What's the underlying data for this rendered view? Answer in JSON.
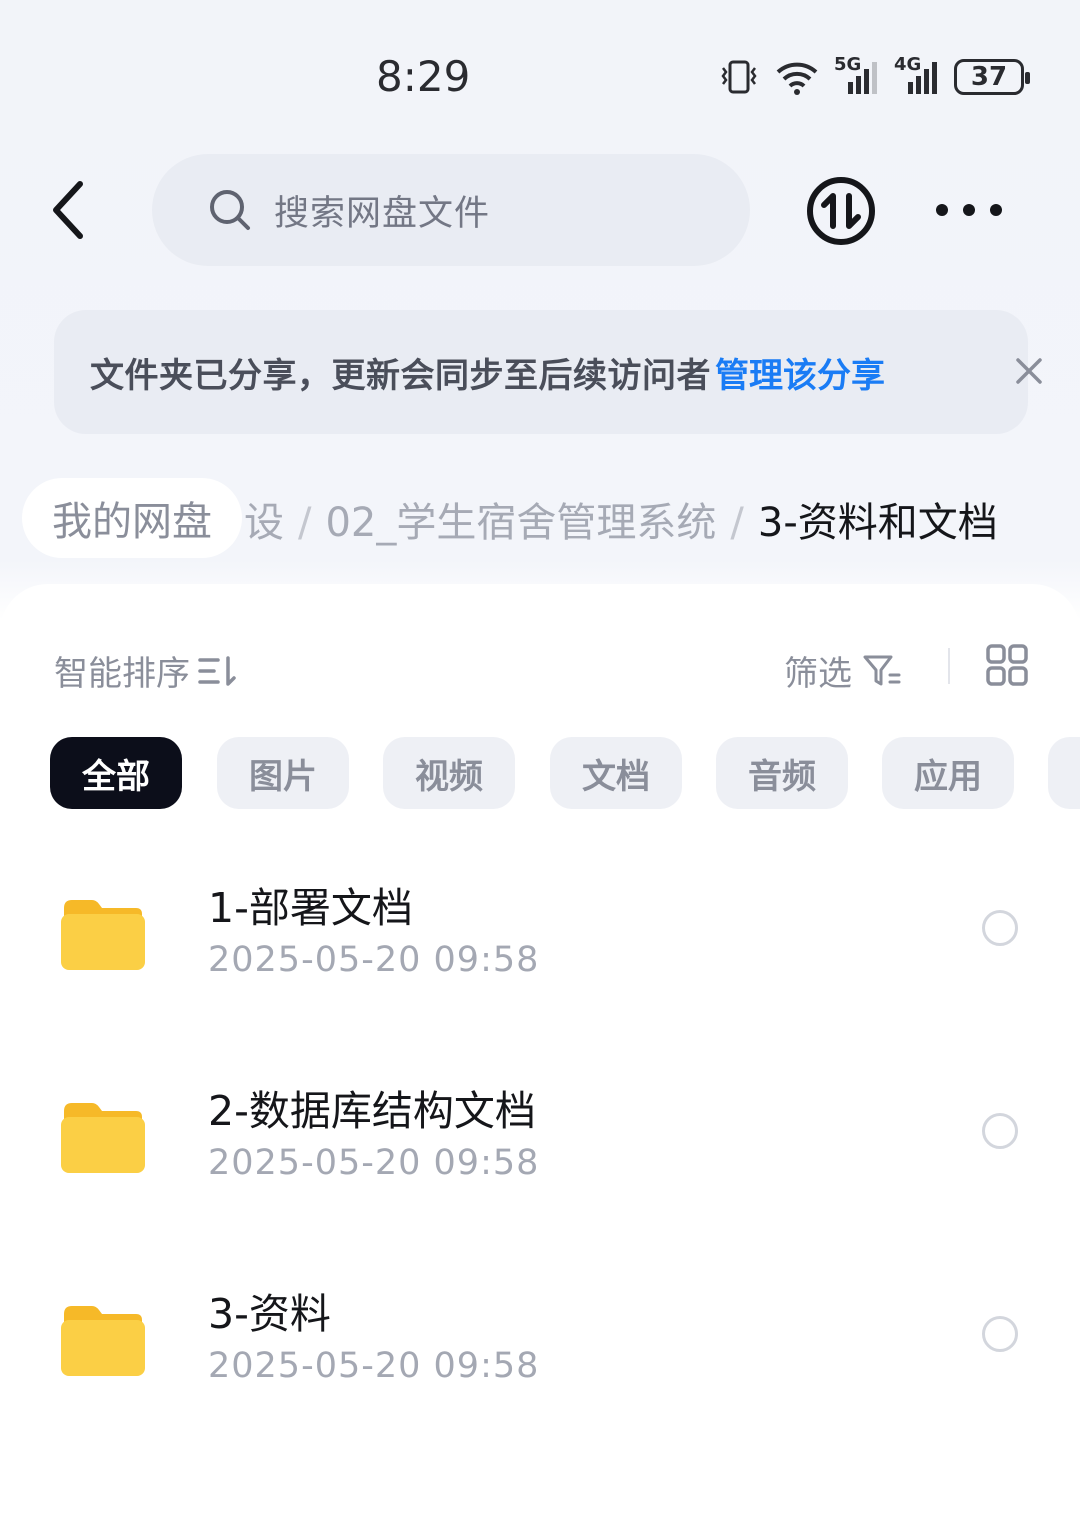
{
  "status_bar": {
    "time": "8:29",
    "battery": "37",
    "net_5g": "5G",
    "net_4g": "4G"
  },
  "search": {
    "placeholder": "搜索网盘文件"
  },
  "notice": {
    "text": "文件夹已分享，更新会同步至后续访问者",
    "link": "管理该分享"
  },
  "breadcrumb": {
    "home": "我的网盘",
    "items": [
      "设",
      "02_学生宿舍管理系统"
    ],
    "current": "3-资料和文档",
    "separator": "/"
  },
  "toolbar": {
    "sort_label": "智能排序",
    "filter_label": "筛选"
  },
  "chips": [
    "全部",
    "图片",
    "视频",
    "文档",
    "音频",
    "应用"
  ],
  "files": [
    {
      "name": "1-部署文档",
      "date": "2025-05-20  09:58"
    },
    {
      "name": "2-数据库结构文档",
      "date": "2025-05-20  09:58"
    },
    {
      "name": "3-资料",
      "date": "2025-05-20  09:58"
    }
  ],
  "colors": {
    "accent": "#1a7cf5",
    "folder": "#f9c938",
    "active_chip": "#0c0e1a"
  }
}
